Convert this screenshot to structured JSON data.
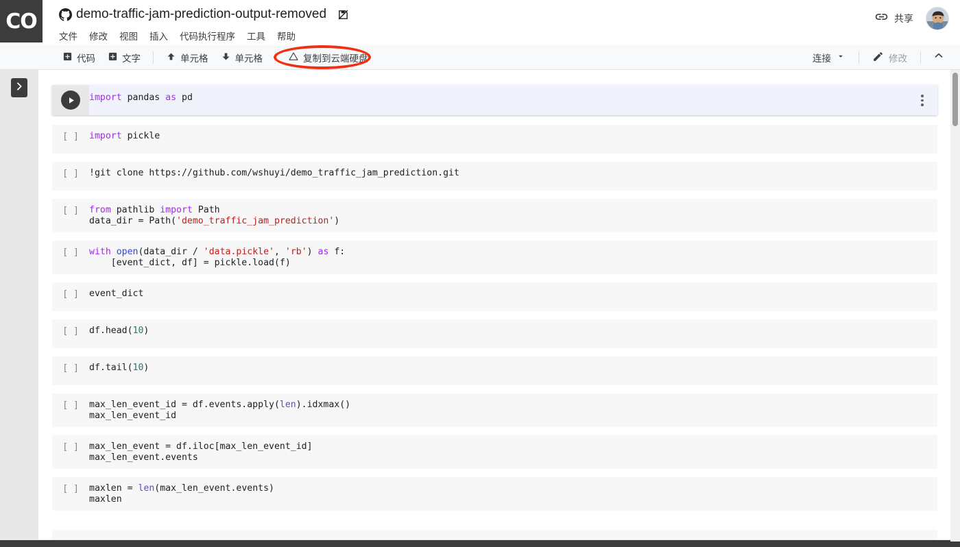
{
  "app": {
    "logo_text": "CO",
    "document_title": "demo-traffic-jam-prediction-output-removed",
    "source_icon": "github-icon",
    "save_state_icon": "save-disabled-icon"
  },
  "menubar": {
    "items": [
      {
        "label": "文件"
      },
      {
        "label": "修改"
      },
      {
        "label": "视图"
      },
      {
        "label": "插入"
      },
      {
        "label": "代码执行程序"
      },
      {
        "label": "工具"
      },
      {
        "label": "帮助"
      }
    ]
  },
  "header_right": {
    "share_label": "共享",
    "share_icon": "link-icon",
    "avatar_name": "user-avatar"
  },
  "toolbar": {
    "add_code_label": "代码",
    "add_text_label": "文字",
    "move_up_label": "单元格",
    "move_down_label": "单元格",
    "copy_to_drive_label": "复制到云端硬盘",
    "connect_label": "连接",
    "edit_label": "修改",
    "collapse_icon": "chevron-up-icon",
    "annotation_color": "#f22f13"
  },
  "sidebar": {
    "toggle_icon": "chevron-right-icon"
  },
  "notebook": {
    "cells": [
      {
        "state": "active",
        "prompt": "",
        "run_icon": "play-icon",
        "lines": [
          [
            {
              "t": "import",
              "c": "kw"
            },
            {
              "t": " pandas ",
              "c": ""
            },
            {
              "t": "as",
              "c": "kw"
            },
            {
              "t": " pd",
              "c": ""
            }
          ]
        ]
      },
      {
        "state": "idle",
        "prompt": "[ ]",
        "lines": [
          [
            {
              "t": "import",
              "c": "kw"
            },
            {
              "t": " pickle",
              "c": ""
            }
          ]
        ]
      },
      {
        "state": "idle",
        "prompt": "[ ]",
        "lines": [
          [
            {
              "t": "!git clone https://github.com/wshuyi/demo_traffic_jam_prediction.git",
              "c": ""
            }
          ]
        ]
      },
      {
        "state": "idle",
        "prompt": "[ ]",
        "lines": [
          [
            {
              "t": "from",
              "c": "kw"
            },
            {
              "t": " pathlib ",
              "c": ""
            },
            {
              "t": "import",
              "c": "kw"
            },
            {
              "t": " Path",
              "c": ""
            }
          ],
          [
            {
              "t": "data_dir = Path(",
              "c": ""
            },
            {
              "t": "'demo_traffic_jam_prediction'",
              "c": "str"
            },
            {
              "t": ")",
              "c": ""
            }
          ]
        ]
      },
      {
        "state": "idle",
        "prompt": "[ ]",
        "lines": [
          [
            {
              "t": "with",
              "c": "kw"
            },
            {
              "t": " ",
              "c": ""
            },
            {
              "t": "open",
              "c": "fn"
            },
            {
              "t": "(data_dir / ",
              "c": ""
            },
            {
              "t": "'data.pickle'",
              "c": "str"
            },
            {
              "t": ", ",
              "c": ""
            },
            {
              "t": "'rb'",
              "c": "str"
            },
            {
              "t": ") ",
              "c": ""
            },
            {
              "t": "as",
              "c": "kw"
            },
            {
              "t": " f:",
              "c": ""
            }
          ],
          [
            {
              "t": "    [event_dict, df] = pickle.load(f)",
              "c": ""
            }
          ]
        ]
      },
      {
        "state": "idle",
        "prompt": "[ ]",
        "lines": [
          [
            {
              "t": "event_dict",
              "c": ""
            }
          ]
        ]
      },
      {
        "state": "idle",
        "prompt": "[ ]",
        "lines": [
          [
            {
              "t": "df.head(",
              "c": ""
            },
            {
              "t": "10",
              "c": "num"
            },
            {
              "t": ")",
              "c": ""
            }
          ]
        ]
      },
      {
        "state": "idle",
        "prompt": "[ ]",
        "lines": [
          [
            {
              "t": "df.tail(",
              "c": ""
            },
            {
              "t": "10",
              "c": "num"
            },
            {
              "t": ")",
              "c": ""
            }
          ]
        ]
      },
      {
        "state": "idle",
        "prompt": "[ ]",
        "lines": [
          [
            {
              "t": "max_len_event_id = df.events.apply(",
              "c": ""
            },
            {
              "t": "len",
              "c": "bi"
            },
            {
              "t": ").idxmax()",
              "c": ""
            }
          ],
          [
            {
              "t": "max_len_event_id",
              "c": ""
            }
          ]
        ]
      },
      {
        "state": "idle",
        "prompt": "[ ]",
        "lines": [
          [
            {
              "t": "max_len_event = df.iloc[max_len_event_id]",
              "c": ""
            }
          ],
          [
            {
              "t": "max_len_event.events",
              "c": ""
            }
          ]
        ]
      },
      {
        "state": "idle",
        "prompt": "[ ]",
        "lines": [
          [
            {
              "t": "maxlen = ",
              "c": ""
            },
            {
              "t": "len",
              "c": "bi"
            },
            {
              "t": "(max_len_event.events)",
              "c": ""
            }
          ],
          [
            {
              "t": "maxlen",
              "c": ""
            }
          ]
        ]
      }
    ]
  }
}
